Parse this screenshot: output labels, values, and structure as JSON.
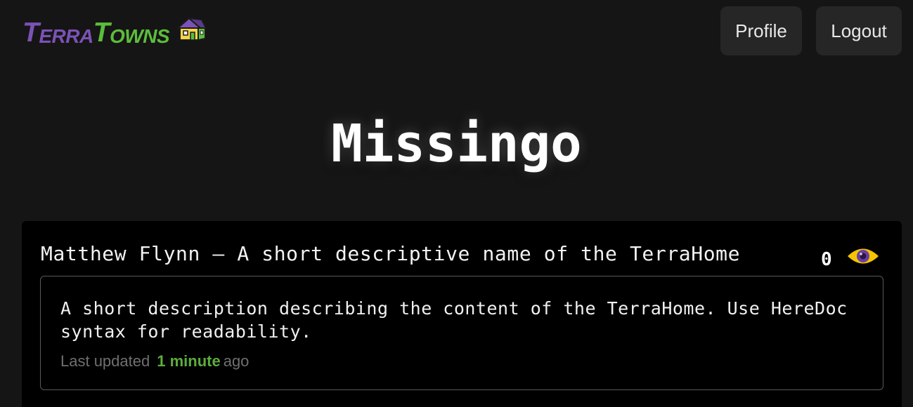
{
  "header": {
    "logo_terra_initial": "T",
    "logo_terra_rest": "ERRA",
    "logo_towns_initial": "T",
    "logo_towns_rest": "OWNS",
    "nav": {
      "profile_label": "Profile",
      "logout_label": "Logout"
    }
  },
  "page": {
    "title": "Missingo"
  },
  "home_card": {
    "heading": "Matthew Flynn — A short descriptive name of the TerraHome",
    "visit_count": "0",
    "description": "A short description describing the content of the TerraHome. Use HereDoc syntax for readability.",
    "updated_prefix": "Last updated",
    "updated_when": "1 minute",
    "updated_suffix": "ago"
  },
  "icons": {
    "logo_house": "house-icon",
    "visits": "eye-icon"
  },
  "colors": {
    "background": "#151515",
    "card_background": "#000000",
    "logo_purple": "#7b52b5",
    "logo_green": "#5cbd3c",
    "eye_yellow": "#f5c400",
    "eye_purple": "#6a3fa0",
    "updated_green": "#5cac3e"
  }
}
